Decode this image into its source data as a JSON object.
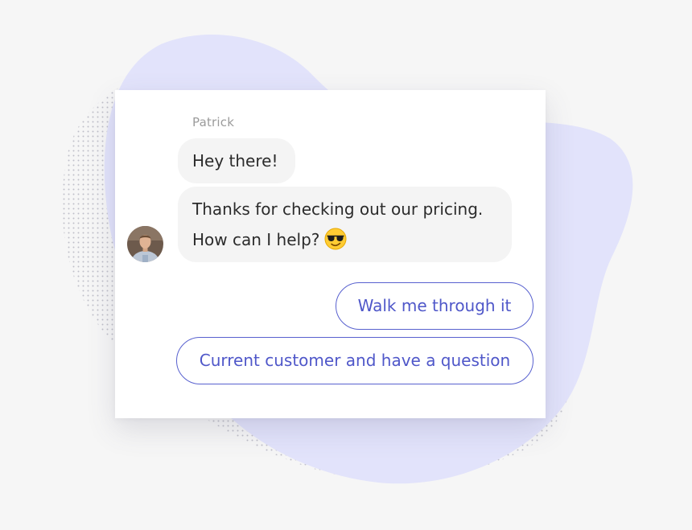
{
  "colors": {
    "background": "#f6f6f6",
    "blob": "#e2e3fb",
    "dots": "#b9b9c4",
    "card": "#ffffff",
    "bubble": "#f4f4f4",
    "accent": "#5861cf"
  },
  "chat": {
    "sender_name": "Patrick",
    "avatar_icon": "person-avatar-icon",
    "messages": [
      {
        "text": "Hey there!"
      },
      {
        "line_1": "Thanks for checking out our pricing.",
        "line_2": "How can I help?",
        "emoji_icon": "sunglasses-emoji-icon"
      }
    ]
  },
  "quick_replies": [
    {
      "label": "Walk me through it"
    },
    {
      "label": "Current customer and have a question"
    }
  ]
}
